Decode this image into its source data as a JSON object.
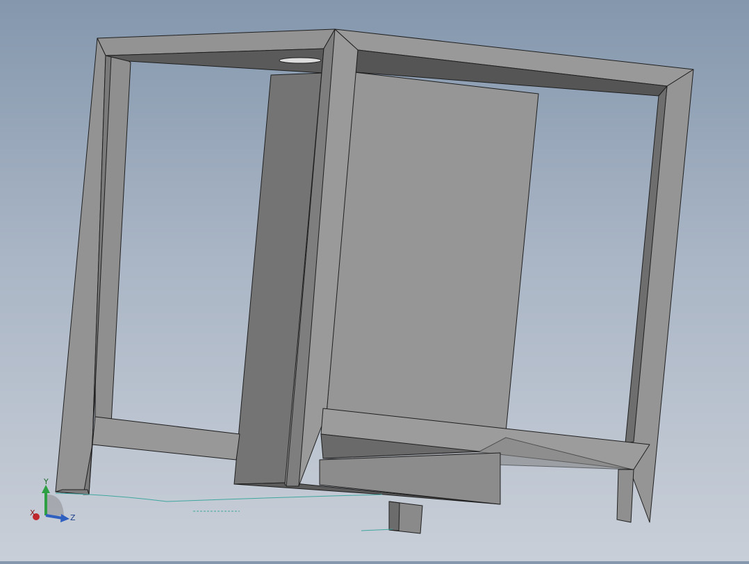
{
  "viewport": {
    "background_top": "#8497ad",
    "background_bottom": "#c9cfd8",
    "model": {
      "description_visible": false,
      "face_colors": {
        "light": "#969696",
        "mid": "#8a8a8a",
        "dark": "#747474",
        "darker": "#5a5a5a",
        "edge": "#1e1e1e"
      }
    }
  },
  "triad": {
    "x_label": "X",
    "y_label": "Y",
    "z_label": "Z",
    "x_color": "#c0272d",
    "y_color": "#2ea043",
    "z_color": "#2f5fbf"
  }
}
